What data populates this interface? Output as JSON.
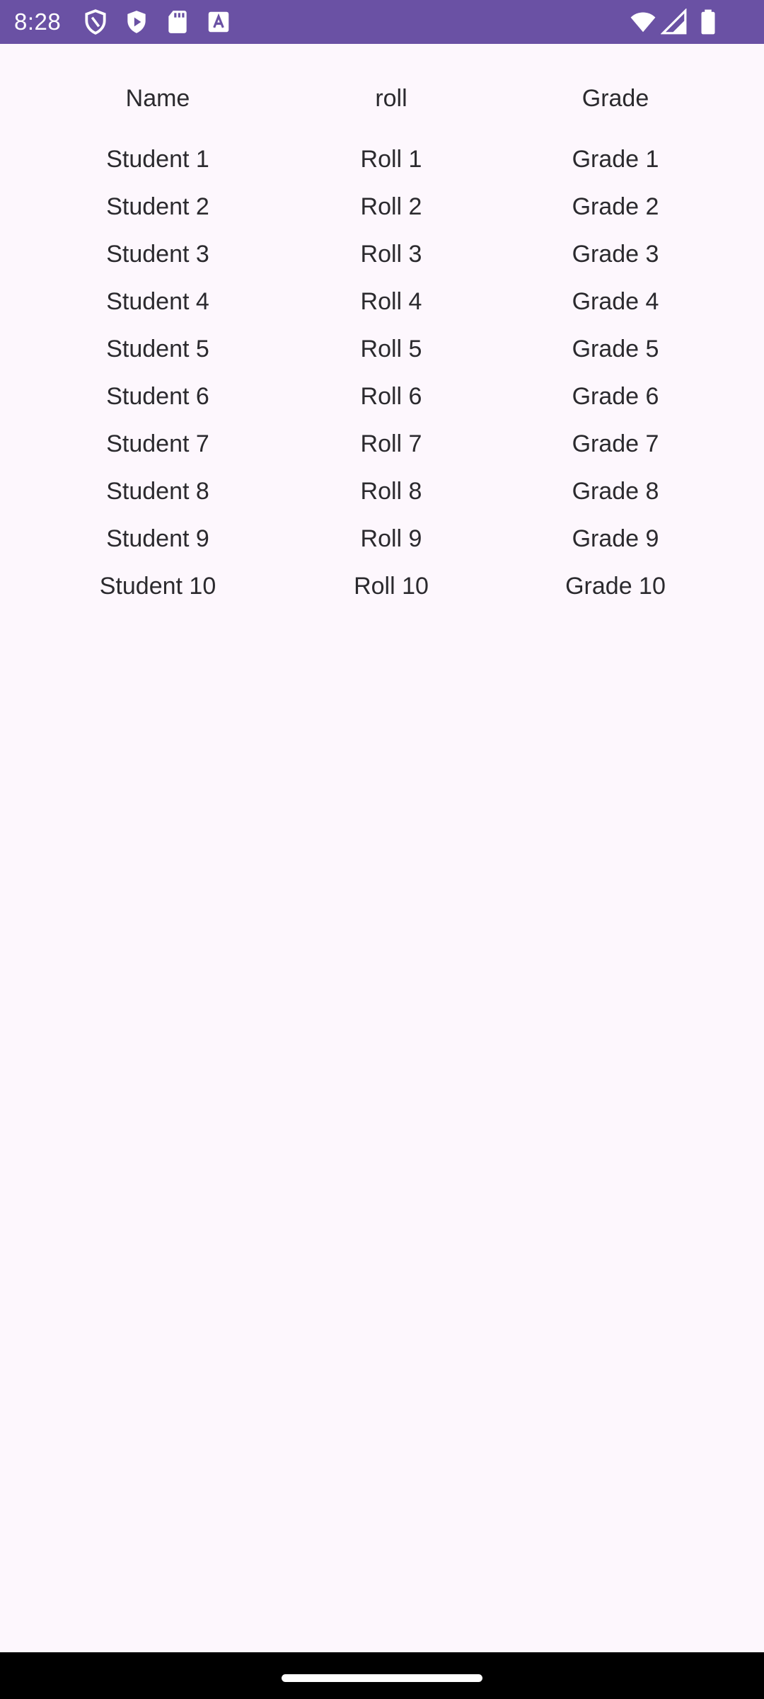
{
  "status_bar": {
    "time": "8:28",
    "left_icons": [
      "shield-outline-icon",
      "play-shield-icon",
      "sd-card-icon",
      "font-a-icon"
    ],
    "right_icons": [
      "wifi-icon",
      "cell-signal-icon",
      "battery-icon"
    ],
    "background": "#6a51a4"
  },
  "table": {
    "headers": [
      "Name",
      "roll",
      "Grade"
    ],
    "rows": [
      [
        "Student 1",
        "Roll 1",
        "Grade 1"
      ],
      [
        "Student 2",
        "Roll 2",
        "Grade 2"
      ],
      [
        "Student 3",
        "Roll 3",
        "Grade 3"
      ],
      [
        "Student 4",
        "Roll 4",
        "Grade 4"
      ],
      [
        "Student 5",
        "Roll 5",
        "Grade 5"
      ],
      [
        "Student 6",
        "Roll 6",
        "Grade 6"
      ],
      [
        "Student 7",
        "Roll 7",
        "Grade 7"
      ],
      [
        "Student 8",
        "Roll 8",
        "Grade 8"
      ],
      [
        "Student 9",
        "Roll 9",
        "Grade 9"
      ],
      [
        "Student 10",
        "Roll 10",
        "Grade 10"
      ]
    ]
  },
  "colors": {
    "page_background": "#fdf7fd",
    "text": "#2b2a2e",
    "nav_bar": "#000000"
  }
}
